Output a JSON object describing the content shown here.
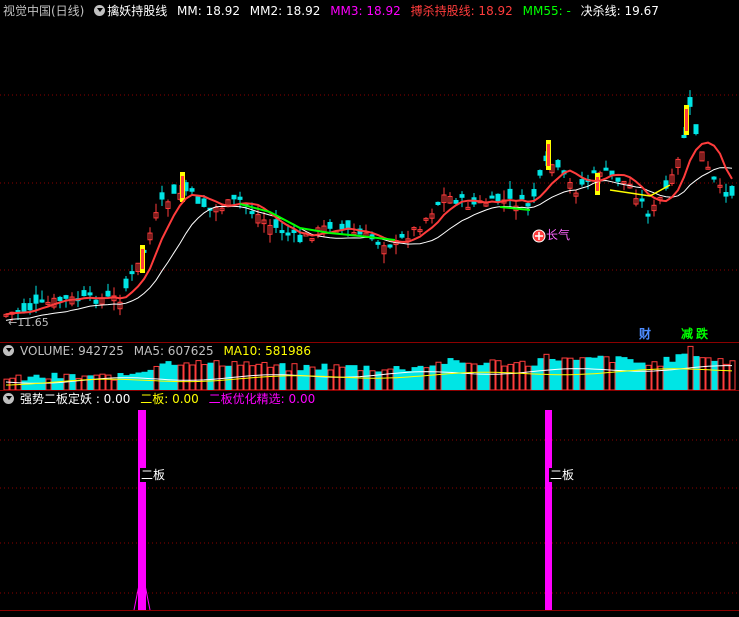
{
  "price_header": {
    "title": "视觉中国(日线)",
    "indicator": "擒妖持股线",
    "mm": "MM: 18.92",
    "mm2": "MM2: 18.92",
    "mm3": "MM3: 18.92",
    "bosha": "搏杀持股线: 18.92",
    "mm55": "MM55: -",
    "juesha": "决杀线: 19.67"
  },
  "price_chart": {
    "low_label": "11.65",
    "signal_label": "长气",
    "flag_cai": "财",
    "flag_jian": "减",
    "flag_die": "跌"
  },
  "volume_header": {
    "volume": "VOLUME: 942725",
    "ma5": "MA5: 607625",
    "ma10": "MA10: 581986"
  },
  "indicator_header": {
    "name": "强势二板定妖 : 0.00",
    "erban": "二板: 0.00",
    "youhua": "二板优化精选: 0.00"
  },
  "indicator_chart": {
    "label_a": "二板",
    "label_b": "二板"
  },
  "colors": {
    "up": "#ff3c3c",
    "down": "#00e5e5",
    "white": "#ffffff",
    "yellow": "#ffff00",
    "magenta": "#ff00ff",
    "green": "#00ff00",
    "grid": "#8b0000"
  }
}
